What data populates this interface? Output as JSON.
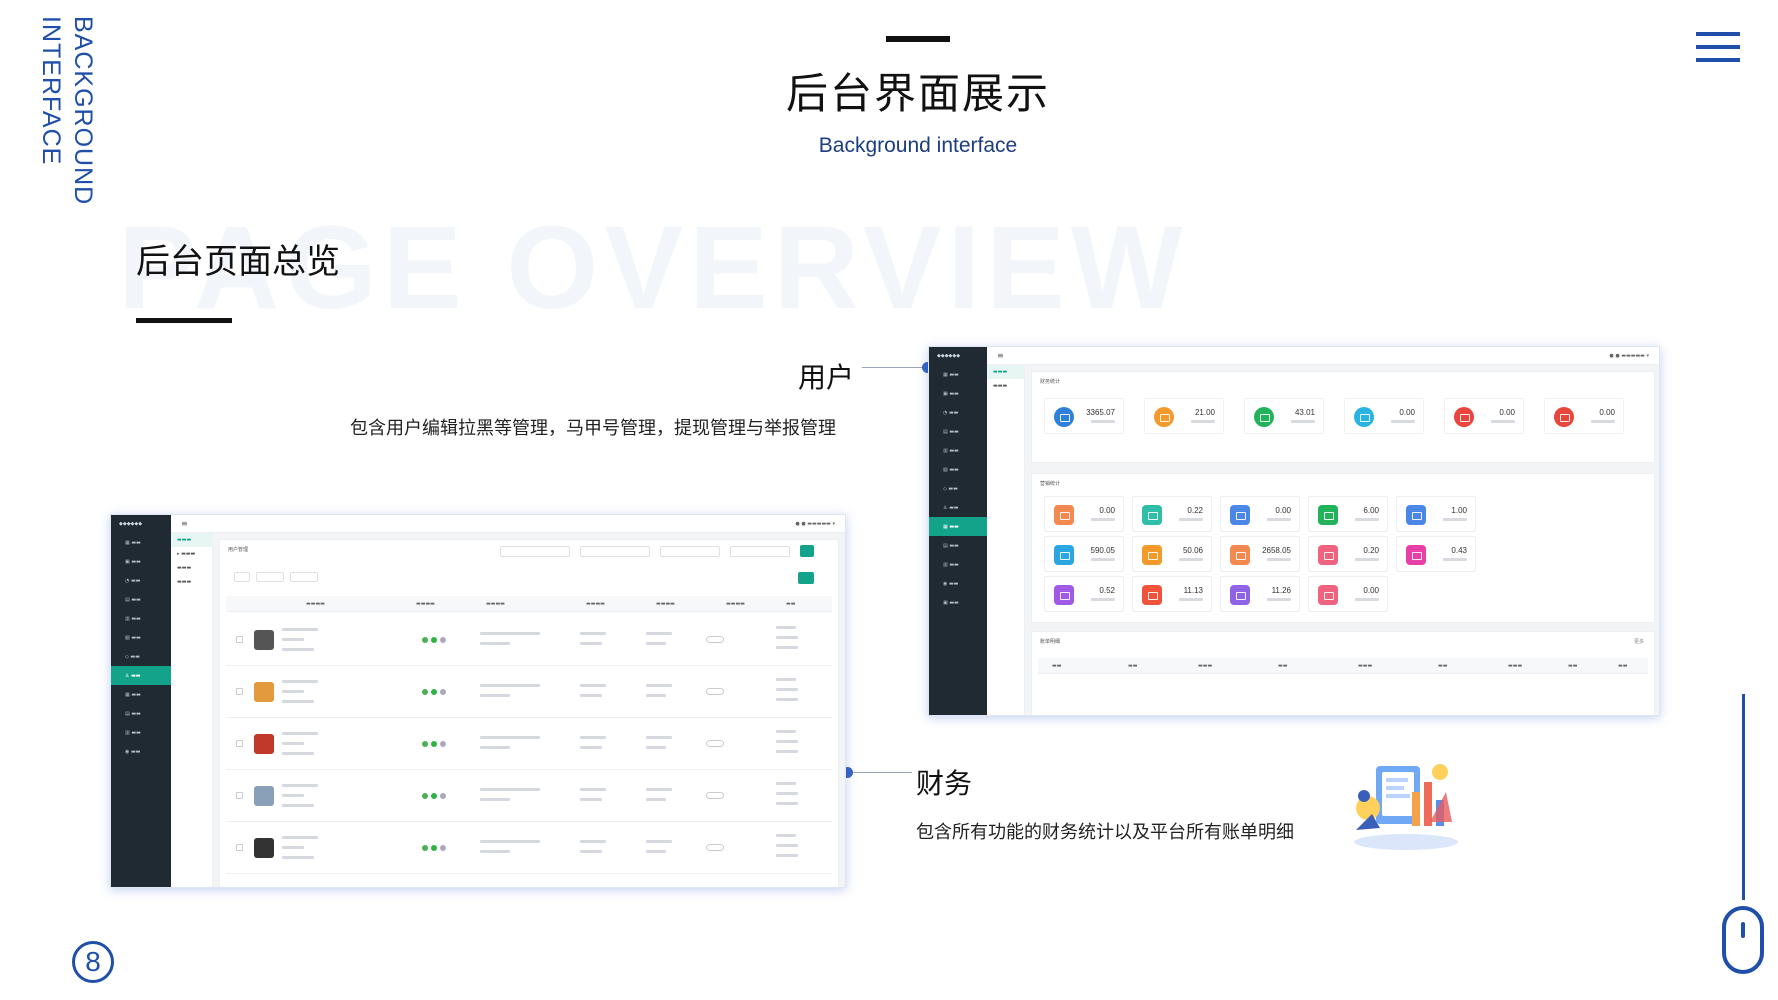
{
  "side_text": {
    "line1": "BACKGROUND",
    "line2": "INTERFACE"
  },
  "header": {
    "title": "后台界面展示",
    "subtitle": "Background interface"
  },
  "section": {
    "watermark": "PAGE OVERVIEW",
    "title": "后台页面总览"
  },
  "callouts": {
    "user": {
      "label": "用户",
      "desc": "包含用户编辑拉黑等管理，马甲号管理，提现管理与举报管理"
    },
    "finance": {
      "label": "财务",
      "desc": "包含所有功能的财务统计以及平台所有账单明细"
    }
  },
  "page_number": "8",
  "icons": [
    "menu-icon",
    "mouse-icon",
    "finance-illustration-icon"
  ],
  "colors": {
    "accent": "#1f4fa8",
    "sidebar": "#1f2a33",
    "active": "#12a38a"
  },
  "finance_shot": {
    "stats_title": "财务统计",
    "stats": [
      {
        "value": "3365.07",
        "color": "#2f80d9"
      },
      {
        "value": "21.00",
        "color": "#f39a2b"
      },
      {
        "value": "43.01",
        "color": "#22b35a"
      },
      {
        "value": "0.00",
        "color": "#28b3e0"
      },
      {
        "value": "0.00",
        "color": "#e8453c"
      },
      {
        "value": "0.00",
        "color": "#e8453c"
      }
    ],
    "ops_title": "营销统计",
    "ops": [
      {
        "value": "0.00",
        "color": "#f3894f"
      },
      {
        "value": "0.22",
        "color": "#2fbfa6"
      },
      {
        "value": "0.00",
        "color": "#4c86e6"
      },
      {
        "value": "6.00",
        "color": "#22b35a"
      },
      {
        "value": "1.00",
        "color": "#4c86e6"
      },
      {
        "value": "590.05",
        "color": "#2aa6e0"
      },
      {
        "value": "50.06",
        "color": "#f39a2b"
      },
      {
        "value": "2658.05",
        "color": "#f3894f"
      },
      {
        "value": "0.20",
        "color": "#f0627e"
      },
      {
        "value": "0.43",
        "color": "#e83fa8"
      },
      {
        "value": "0.52",
        "color": "#a05ae6"
      },
      {
        "value": "11.13",
        "color": "#f0523c"
      },
      {
        "value": "11.26",
        "color": "#8f62e6"
      },
      {
        "value": "0.00",
        "color": "#f0627e"
      }
    ],
    "bill_title": "账单明细",
    "bill_more": "更多"
  },
  "user_shot": {
    "panel_title": "用户管理",
    "rows": [
      {
        "av": "#555"
      },
      {
        "av": "#e39a3c"
      },
      {
        "av": "#c0392b"
      },
      {
        "av": "#8aa0b8"
      },
      {
        "av": "#333"
      }
    ]
  }
}
